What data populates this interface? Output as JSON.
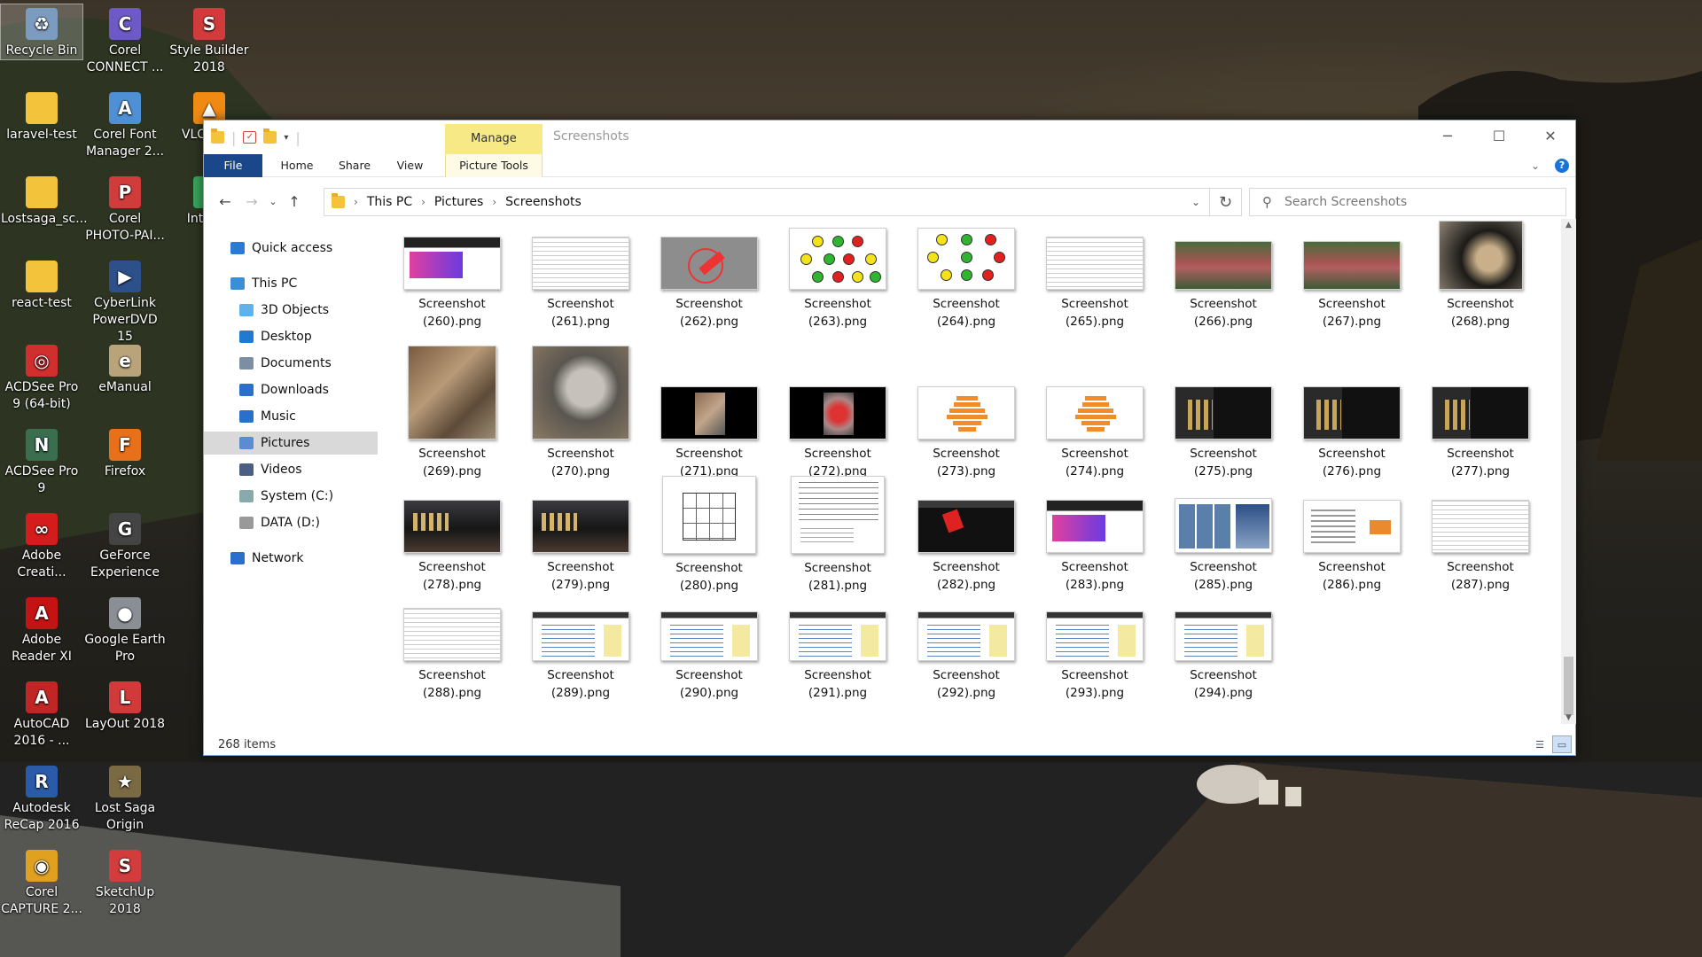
{
  "desktop_icons": [
    {
      "label": "Recycle Bin",
      "color": "#7b9bbf",
      "glyph": "♻",
      "icon": "recycle-bin-icon"
    },
    {
      "label": "Corel CONNECT ...",
      "color": "#6d5ac6",
      "glyph": "C",
      "icon": "corel-connect-icon"
    },
    {
      "label": "Style Builder 2018",
      "color": "#d23b3b",
      "glyph": "S",
      "icon": "style-builder-icon"
    },
    {
      "label": "laravel-test",
      "color": "#f3c33b",
      "glyph": "",
      "icon": "folder-icon"
    },
    {
      "label": "Corel Font Manager 2...",
      "color": "#4f8fd4",
      "glyph": "A",
      "icon": "corel-font-manager-icon"
    },
    {
      "label": "VLC ... pl",
      "color": "#f08a12",
      "glyph": "▲",
      "icon": "vlc-icon"
    },
    {
      "label": "Lostsaga_sc...",
      "color": "#f3c33b",
      "glyph": "",
      "icon": "folder-icon"
    },
    {
      "label": "Corel PHOTO-PAI...",
      "color": "#d03c3c",
      "glyph": "P",
      "icon": "corel-photo-paint-icon"
    },
    {
      "label": "Int Dov",
      "color": "#3aa65b",
      "glyph": "I",
      "icon": "downloader-icon"
    },
    {
      "label": "react-test",
      "color": "#f3c33b",
      "glyph": "",
      "icon": "folder-icon"
    },
    {
      "label": "CyberLink PowerDVD 15",
      "color": "#2d4f8a",
      "glyph": "▶",
      "icon": "powerdvd-icon"
    },
    {
      "label": "ACDSee Pro 9 (64-bit)",
      "color": "#d12e2e",
      "glyph": "◎",
      "icon": "acdsee-icon"
    },
    {
      "label": "eManual",
      "color": "#b9a37a",
      "glyph": "e",
      "icon": "emanual-icon"
    },
    {
      "label": "ACDSee Pro 9",
      "color": "#3a6e4e",
      "glyph": "N",
      "icon": "acdsee-whatsnew-icon"
    },
    {
      "label": "Firefox",
      "color": "#e8701a",
      "glyph": "F",
      "icon": "firefox-icon"
    },
    {
      "label": "Adobe Creati...",
      "color": "#d41c1c",
      "glyph": "∞",
      "icon": "adobe-creative-cloud-icon"
    },
    {
      "label": "GeForce Experience",
      "color": "#444",
      "glyph": "G",
      "icon": "geforce-icon"
    },
    {
      "label": "Adobe Reader XI",
      "color": "#c41313",
      "glyph": "A",
      "icon": "adobe-reader-icon"
    },
    {
      "label": "Google Earth Pro",
      "color": "#8a8f96",
      "glyph": "●",
      "icon": "google-earth-icon"
    },
    {
      "label": "AutoCAD 2016 - ...",
      "color": "#c02626",
      "glyph": "A",
      "icon": "autocad-icon"
    },
    {
      "label": "LayOut 2018",
      "color": "#d03a3a",
      "glyph": "L",
      "icon": "layout-icon"
    },
    {
      "label": "Autodesk ReCap 2016",
      "color": "#2a5aa8",
      "glyph": "R",
      "icon": "recap-icon"
    },
    {
      "label": "Lost Saga Origin",
      "color": "#7a6a44",
      "glyph": "★",
      "icon": "lost-saga-icon"
    },
    {
      "label": "Corel CAPTURE 2...",
      "color": "#e0a020",
      "glyph": "◉",
      "icon": "corel-capture-icon"
    },
    {
      "label": "SketchUp 2018",
      "color": "#d33c3c",
      "glyph": "S",
      "icon": "sketchup-icon"
    }
  ],
  "window": {
    "title": "Screenshots",
    "manage_tab": "Manage",
    "tabs": {
      "file": "File",
      "home": "Home",
      "share": "Share",
      "view": "View",
      "picture_tools": "Picture Tools"
    },
    "breadcrumb": [
      "This PC",
      "Pictures",
      "Screenshots"
    ],
    "search_placeholder": "Search Screenshots",
    "status": "268 items"
  },
  "nav": [
    {
      "label": "Quick access",
      "icon": "star-icon",
      "color": "#2b7bd6"
    },
    {
      "label": "This PC",
      "icon": "computer-icon",
      "color": "#3b8fd8"
    },
    {
      "label": "3D Objects",
      "icon": "cube-icon",
      "color": "#5fb3e8"
    },
    {
      "label": "Desktop",
      "icon": "desktop-icon",
      "color": "#1f7ad0"
    },
    {
      "label": "Documents",
      "icon": "document-icon",
      "color": "#7c8ea3"
    },
    {
      "label": "Downloads",
      "icon": "download-icon",
      "color": "#2a6fc9"
    },
    {
      "label": "Music",
      "icon": "music-icon",
      "color": "#2a6fc9"
    },
    {
      "label": "Pictures",
      "icon": "pictures-icon",
      "color": "#5b8bd0"
    },
    {
      "label": "Videos",
      "icon": "video-icon",
      "color": "#4a5f83"
    },
    {
      "label": "System (C:)",
      "icon": "drive-c-icon",
      "color": "#8aa"
    },
    {
      "label": "DATA (D:)",
      "icon": "drive-d-icon",
      "color": "#999"
    },
    {
      "label": "Network",
      "icon": "network-icon",
      "color": "#2a6fc9"
    }
  ],
  "files": [
    {
      "name1": "Screenshot",
      "name2": "(260).png",
      "kind": "web"
    },
    {
      "name1": "Screenshot",
      "name2": "(261).png",
      "kind": "doc"
    },
    {
      "name1": "Screenshot",
      "name2": "(262).png",
      "kind": "map"
    },
    {
      "name1": "Screenshot",
      "name2": "(263).png",
      "kind": "graph"
    },
    {
      "name1": "Screenshot",
      "name2": "(264).png",
      "kind": "graph2"
    },
    {
      "name1": "Screenshot",
      "name2": "(265).png",
      "kind": "doc"
    },
    {
      "name1": "Screenshot",
      "name2": "(266).png",
      "kind": "aerial"
    },
    {
      "name1": "Screenshot",
      "name2": "(267).png",
      "kind": "aerial"
    },
    {
      "name1": "Screenshot",
      "name2": "(268).png",
      "kind": "photo"
    },
    {
      "name1": "Screenshot",
      "name2": "(269).png",
      "kind": "photo2"
    },
    {
      "name1": "Screenshot",
      "name2": "(270).png",
      "kind": "photo3"
    },
    {
      "name1": "Screenshot",
      "name2": "(271).png",
      "kind": "video"
    },
    {
      "name1": "Screenshot",
      "name2": "(272).png",
      "kind": "video2"
    },
    {
      "name1": "Screenshot",
      "name2": "(273).png",
      "kind": "chart"
    },
    {
      "name1": "Screenshot",
      "name2": "(274).png",
      "kind": "chart"
    },
    {
      "name1": "Screenshot",
      "name2": "(275).png",
      "kind": "dark"
    },
    {
      "name1": "Screenshot",
      "name2": "(276).png",
      "kind": "dark"
    },
    {
      "name1": "Screenshot",
      "name2": "(277).png",
      "kind": "dark"
    },
    {
      "name1": "Screenshot",
      "name2": "(278).png",
      "kind": "darkgame"
    },
    {
      "name1": "Screenshot",
      "name2": "(279).png",
      "kind": "darkgame"
    },
    {
      "name1": "Screenshot",
      "name2": "(280).png",
      "kind": "plan"
    },
    {
      "name1": "Screenshot",
      "name2": "(281).png",
      "kind": "table"
    },
    {
      "name1": "Screenshot",
      "name2": "(282).png",
      "kind": "cad"
    },
    {
      "name1": "Screenshot",
      "name2": "(283).png",
      "kind": "web"
    },
    {
      "name1": "Screenshot",
      "name2": "(285).png",
      "kind": "gallery"
    },
    {
      "name1": "Screenshot",
      "name2": "(286).png",
      "kind": "web2"
    },
    {
      "name1": "Screenshot",
      "name2": "(287).png",
      "kind": "doc"
    },
    {
      "name1": "Screenshot",
      "name2": "(288).png",
      "kind": "doc"
    },
    {
      "name1": "Screenshot",
      "name2": "(289).png",
      "kind": "ide"
    },
    {
      "name1": "Screenshot",
      "name2": "(290).png",
      "kind": "ide"
    },
    {
      "name1": "Screenshot",
      "name2": "(291).png",
      "kind": "ide"
    },
    {
      "name1": "Screenshot",
      "name2": "(292).png",
      "kind": "ide"
    },
    {
      "name1": "Screenshot",
      "name2": "(293).png",
      "kind": "ide"
    },
    {
      "name1": "Screenshot",
      "name2": "(294).png",
      "kind": "ide"
    }
  ]
}
